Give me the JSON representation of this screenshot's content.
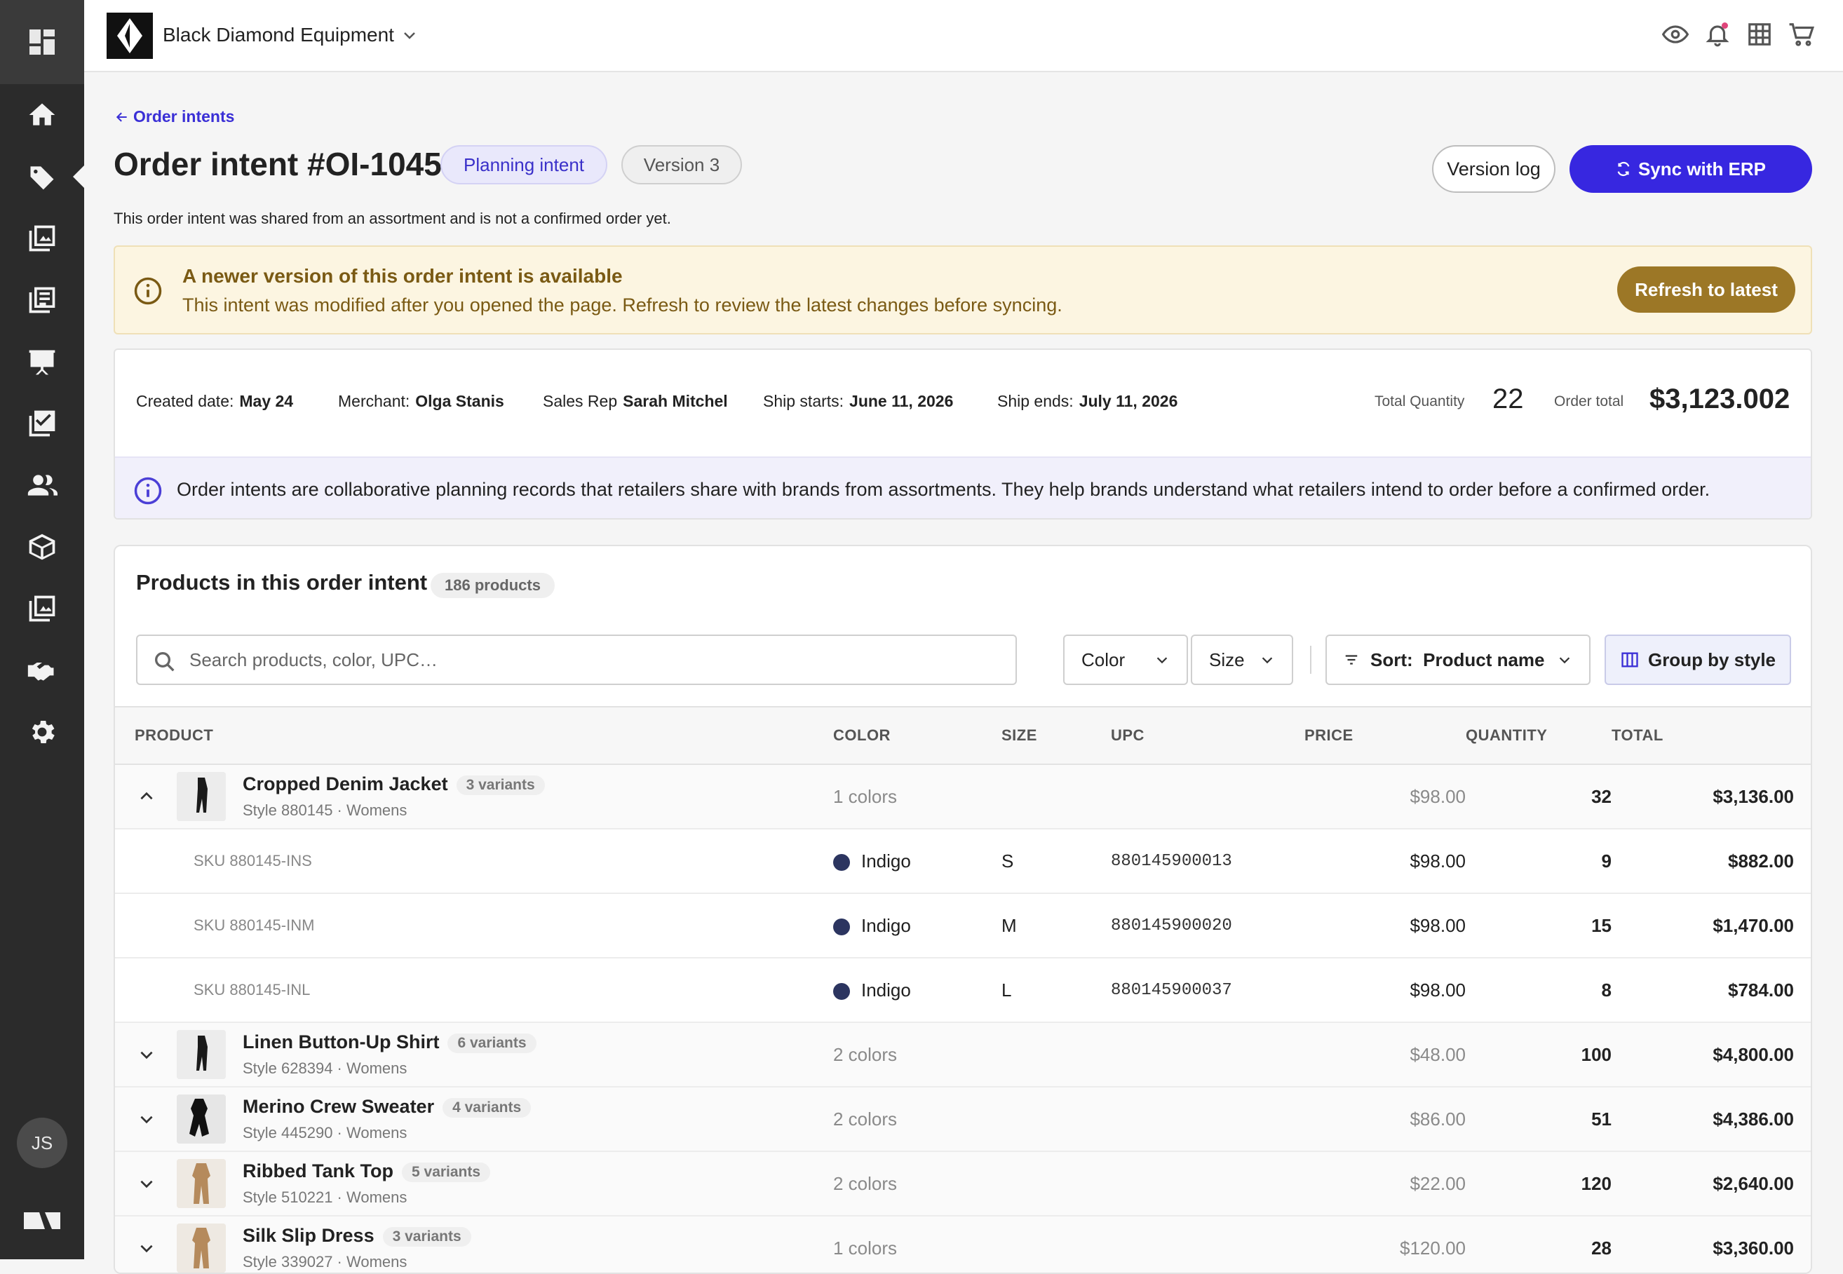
{
  "brand": {
    "name": "Black Diamond Equipment"
  },
  "sidebar": {
    "items": [
      {
        "icon": "home-icon"
      },
      {
        "icon": "tag-icon"
      },
      {
        "icon": "catalog-icon"
      },
      {
        "icon": "document-list-icon"
      },
      {
        "icon": "presentation-icon"
      },
      {
        "icon": "checklist-icon"
      },
      {
        "icon": "users-icon"
      },
      {
        "icon": "box-icon"
      },
      {
        "icon": "gallery-icon"
      },
      {
        "icon": "handshake-icon"
      },
      {
        "icon": "settings-icon"
      }
    ],
    "avatar_initials": "JS"
  },
  "header": {
    "icons": [
      "eye-icon",
      "bell-icon",
      "grid-icon",
      "cart-icon"
    ]
  },
  "page": {
    "back_label": "Order intents",
    "title": "Order intent #OI-1045",
    "pill_planning": "Planning intent",
    "pill_version": "Version 3",
    "version_log_label": "Version log",
    "sync_label": "Sync with ERP",
    "subtitle": "This order intent was shared from an assortment and is not a confirmed order yet."
  },
  "warning": {
    "title": "A newer version of this order intent is available",
    "text": "This intent was modified after you opened the page. Refresh to review the latest changes before syncing.",
    "button": "Refresh to latest"
  },
  "summary": {
    "created_label": "Created date:",
    "created_value": "May 24",
    "merchant_label": "Merchant:",
    "merchant_value": "Olga Stanis",
    "salesrep_label": "Sales Rep",
    "salesrep_value": "Sarah Mitchel",
    "shipstart_label": "Ship starts:",
    "shipstart_value": "June 11, 2026",
    "shipend_label": "Ship ends:",
    "shipend_value": "July 11, 2026",
    "total_qty_label": "Total Quantity",
    "total_qty_value": "22",
    "order_total_label": "Order total",
    "order_total_value": "$3,123.002",
    "info": "Order intents are collaborative planning records that retailers share with brands from assortments. They help brands understand what retailers intend to order before a confirmed order."
  },
  "products": {
    "title": "Products in this order intent",
    "count": "186 products",
    "search_placeholder": "Search products, color, UPC…",
    "filter_color": "Color",
    "filter_size": "Size",
    "sort_prefix": "Sort:",
    "sort_value": "Product name",
    "group_label": "Group by style",
    "columns": [
      "PRODUCT",
      "COLOR",
      "SIZE",
      "UPC",
      "PRICE",
      "QUANTITY",
      "TOTAL"
    ],
    "rows": [
      {
        "name": "Cropped Denim Jacket",
        "variants": "3 variants",
        "style": "Style 880145 · Womens",
        "colors": "1 colors",
        "price": "$98.00",
        "qty": "32",
        "total": "$3,136.00"
      },
      {
        "name": "Linen Button-Up Shirt",
        "variants": "6 variants",
        "style": "Style 628394 · Womens",
        "colors": "2 colors",
        "price": "$48.00",
        "qty": "100",
        "total": "$4,800.00"
      },
      {
        "name": "Merino Crew Sweater",
        "variants": "4 variants",
        "style": "Style 445290 · Womens",
        "colors": "2 colors",
        "price": "$86.00",
        "qty": "51",
        "total": "$4,386.00"
      },
      {
        "name": "Ribbed Tank Top",
        "variants": "5 variants",
        "style": "Style 510221 · Womens",
        "colors": "2 colors",
        "price": "$22.00",
        "qty": "120",
        "total": "$2,640.00"
      },
      {
        "name": "Silk Slip Dress",
        "variants": "3 variants",
        "style": "Style 339027 · Womens",
        "colors": "1 colors",
        "price": "$120.00",
        "qty": "28",
        "total": "$3,360.00"
      }
    ],
    "skus": [
      {
        "sku": "SKU 880145-INS",
        "color": "Indigo",
        "size": "S",
        "upc": "880145900013",
        "price": "$98.00",
        "qty": "9",
        "total": "$882.00"
      },
      {
        "sku": "SKU 880145-INM",
        "color": "Indigo",
        "size": "M",
        "upc": "880145900020",
        "price": "$98.00",
        "qty": "15",
        "total": "$1,470.00"
      },
      {
        "sku": "SKU 880145-INL",
        "color": "Indigo",
        "size": "L",
        "upc": "880145900037",
        "price": "$98.00",
        "qty": "8",
        "total": "$784.00"
      }
    ]
  },
  "colors": {
    "accent": "#3727e0",
    "warning_button": "#9c7726",
    "sidebar": "#2b2b2b",
    "indigo_swatch": "#2c3560"
  }
}
